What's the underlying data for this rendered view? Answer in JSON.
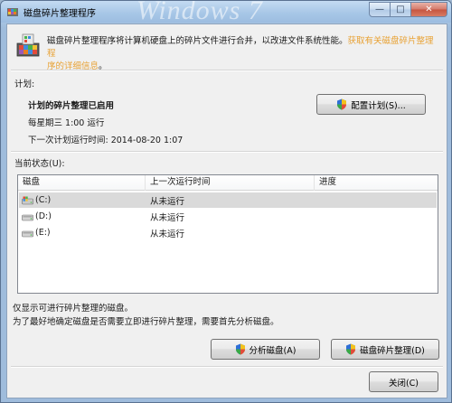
{
  "window": {
    "title": "磁盘碎片整理程序",
    "watermark": "Windows 7",
    "controls": {
      "minimize": "—",
      "maximize": "□",
      "close": "✕"
    }
  },
  "header": {
    "description": "磁盘碎片整理程序将计算机硬盘上的碎片文件进行合并，以改进文件系统性能。",
    "link_line1": "获取有关磁盘碎片整理程",
    "link_line2": "序的详细信息",
    "period": "。"
  },
  "schedule": {
    "section_label": "计划:",
    "status": "计划的碎片整理已启用",
    "frequency": "每星期三  1:00 运行",
    "next_run": "下一次计划运行时间: 2014-08-20 1:07",
    "configure_button": "配置计划(S)..."
  },
  "current_status": {
    "section_label": "当前状态(U):",
    "columns": [
      "磁盘",
      "上一次运行时间",
      "进度"
    ],
    "rows": [
      {
        "disk": "(C:)",
        "last_run": "从未运行",
        "progress": "",
        "icon": "system-drive-icon"
      },
      {
        "disk": "(D:)",
        "last_run": "从未运行",
        "progress": "",
        "icon": "hard-drive-icon"
      },
      {
        "disk": "(E:)",
        "last_run": "从未运行",
        "progress": "",
        "icon": "hard-drive-icon"
      }
    ]
  },
  "footer": {
    "note1": "仅显示可进行碎片整理的磁盘。",
    "note2": "为了最好地确定磁盘是否需要立即进行碎片整理，需要首先分析磁盘。",
    "analyze_button": "分析磁盘(A)",
    "defrag_button": "磁盘碎片整理(D)",
    "close_button": "关闭(C)"
  },
  "colors": {
    "link": "#e8a235",
    "selected_row": "#dadada",
    "titlebar": "#a8c7e7"
  }
}
